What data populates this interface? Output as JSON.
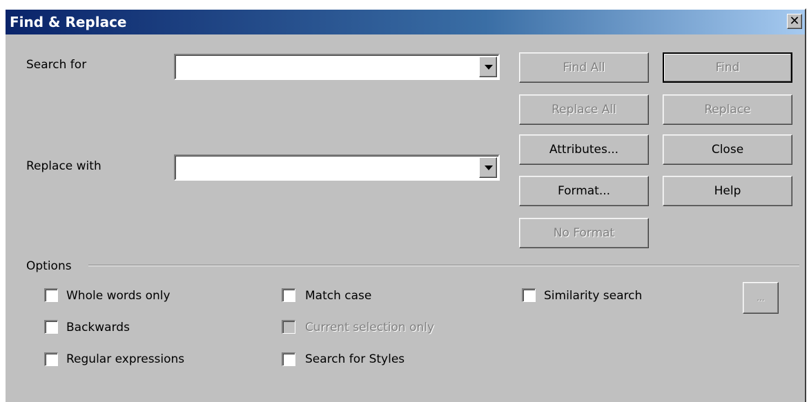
{
  "window": {
    "title": "Find & Replace",
    "close_glyph": "✕"
  },
  "search": {
    "label": "Search for",
    "value": "",
    "placeholder": ""
  },
  "replace": {
    "label": "Replace with",
    "value": "",
    "placeholder": ""
  },
  "buttons": {
    "find_all": "Find All",
    "find": "Find",
    "replace_all": "Replace All",
    "replace": "Replace",
    "attributes": "Attributes...",
    "close": "Close",
    "format": "Format...",
    "help": "Help",
    "no_format": "No Format",
    "similarity_more": "..."
  },
  "options": {
    "heading": "Options",
    "whole_words": "Whole words only",
    "match_case": "Match case",
    "similarity": "Similarity search",
    "backwards": "Backwards",
    "current_selection": "Current selection only",
    "regex": "Regular expressions",
    "styles": "Search for Styles"
  },
  "colors": {
    "dialog_bg": "#c0c0c0",
    "title_start": "#0a246a",
    "title_end": "#a6caf0",
    "disabled_text": "#808080"
  },
  "icons": [
    "close-icon",
    "chevron-down-icon"
  ]
}
